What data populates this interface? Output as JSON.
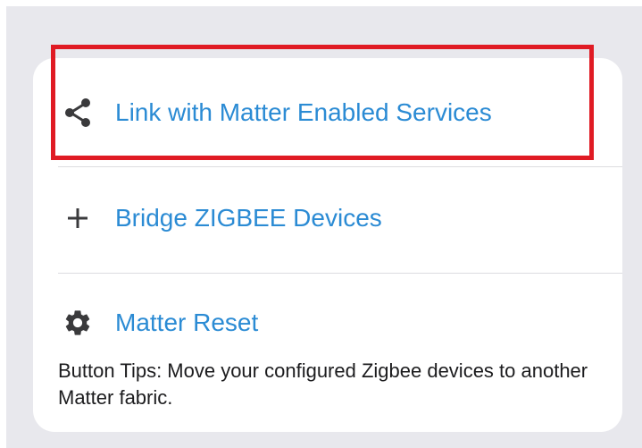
{
  "menu": {
    "items": [
      {
        "label": "Link with Matter Enabled Services",
        "icon": "share-icon"
      },
      {
        "label": "Bridge ZIGBEE Devices",
        "icon": "plus-icon"
      },
      {
        "label": "Matter Reset",
        "icon": "gear-icon"
      }
    ],
    "tips": "Button Tips: Move your configured Zigbee devices to another Matter fabric."
  },
  "colors": {
    "background": "#e8e8ed",
    "card": "#ffffff",
    "link": "#2b8bd4",
    "icon": "#3a3a3c",
    "highlight": "#e01b24"
  }
}
